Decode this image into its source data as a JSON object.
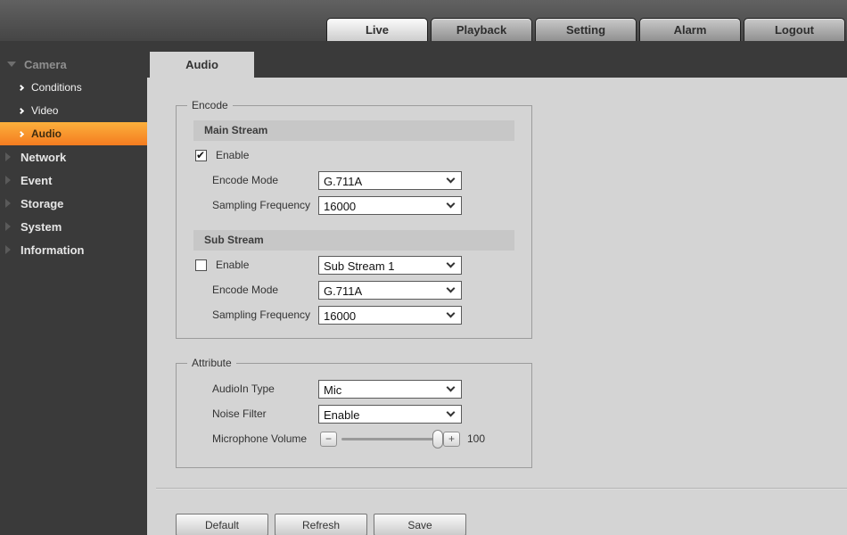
{
  "header": {
    "tabs": [
      {
        "label": "Live",
        "active": true
      },
      {
        "label": "Playback",
        "active": false
      },
      {
        "label": "Setting",
        "active": false
      },
      {
        "label": "Alarm",
        "active": false
      },
      {
        "label": "Logout",
        "active": false
      }
    ]
  },
  "sidebar": {
    "sections": [
      {
        "label": "Camera",
        "expanded": true,
        "children": [
          {
            "label": "Conditions",
            "active": false
          },
          {
            "label": "Video",
            "active": false
          },
          {
            "label": "Audio",
            "active": true
          }
        ]
      },
      {
        "label": "Network"
      },
      {
        "label": "Event"
      },
      {
        "label": "Storage"
      },
      {
        "label": "System"
      },
      {
        "label": "Information"
      }
    ]
  },
  "page": {
    "tab_label": "Audio"
  },
  "encode": {
    "legend": "Encode",
    "main_stream": {
      "title": "Main Stream",
      "enable_label": "Enable",
      "enable_checked": true,
      "encode_mode_label": "Encode Mode",
      "encode_mode_value": "G.711A",
      "sampling_frequency_label": "Sampling Frequency",
      "sampling_frequency_value": "16000"
    },
    "sub_stream": {
      "title": "Sub Stream",
      "enable_label": "Enable",
      "enable_checked": false,
      "stream_value": "Sub Stream 1",
      "encode_mode_label": "Encode Mode",
      "encode_mode_value": "G.711A",
      "sampling_frequency_label": "Sampling Frequency",
      "sampling_frequency_value": "16000"
    }
  },
  "attribute": {
    "legend": "Attribute",
    "audioin_type_label": "AudioIn Type",
    "audioin_type_value": "Mic",
    "noise_filter_label": "Noise Filter",
    "noise_filter_value": "Enable",
    "microphone_volume_label": "Microphone Volume",
    "microphone_volume_value": "100",
    "volume_percent": 100,
    "volume_minus": "−",
    "volume_plus": "+"
  },
  "actions": {
    "default_label": "Default",
    "refresh_label": "Refresh",
    "save_label": "Save"
  },
  "colors": {
    "accent_orange_top": "#fcb03c",
    "accent_orange_bottom": "#f47c20",
    "header_bg": "#555555",
    "nav_bg": "#3a3a3a",
    "content_bg": "#d4d4d4",
    "stream_bar_bg": "#c7c7c7"
  }
}
